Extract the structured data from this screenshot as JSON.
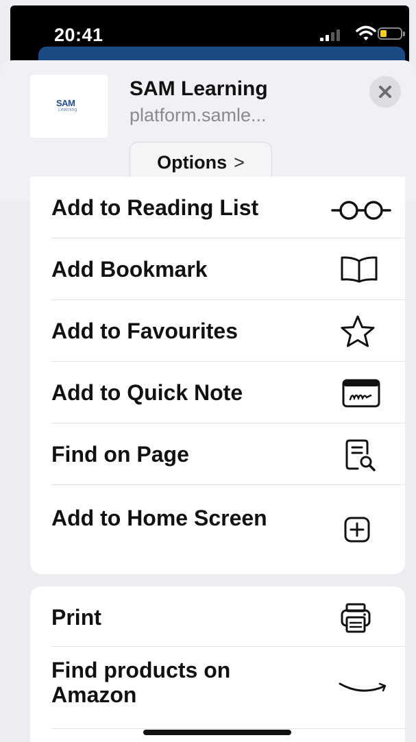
{
  "status_bar": {
    "time": "20:41"
  },
  "header": {
    "logo_text": "SAM",
    "logo_sub": "Learning",
    "title": "SAM Learning",
    "url": "platform.samle...",
    "options_label": "Options",
    "options_chevron": ">"
  },
  "menu": {
    "group1": [
      {
        "label": "Add to Reading List",
        "icon": "glasses-icon"
      },
      {
        "label": "Add Bookmark",
        "icon": "book-icon"
      },
      {
        "label": "Add to Favourites",
        "icon": "star-icon"
      },
      {
        "label": "Add to Quick Note",
        "icon": "quick-note-icon"
      },
      {
        "label": "Find on Page",
        "icon": "find-on-page-icon"
      },
      {
        "label": "Add to Home Screen",
        "icon": "plus-square-icon"
      }
    ],
    "group2": [
      {
        "label": "Print",
        "icon": "printer-icon"
      },
      {
        "label": "Find products on Amazon",
        "icon": "amazon-smile-icon"
      }
    ]
  },
  "colors": {
    "accent_blue": "#1b4a84",
    "battery_low": "#ffcc00",
    "logo_blue": "#1f4c9c"
  }
}
